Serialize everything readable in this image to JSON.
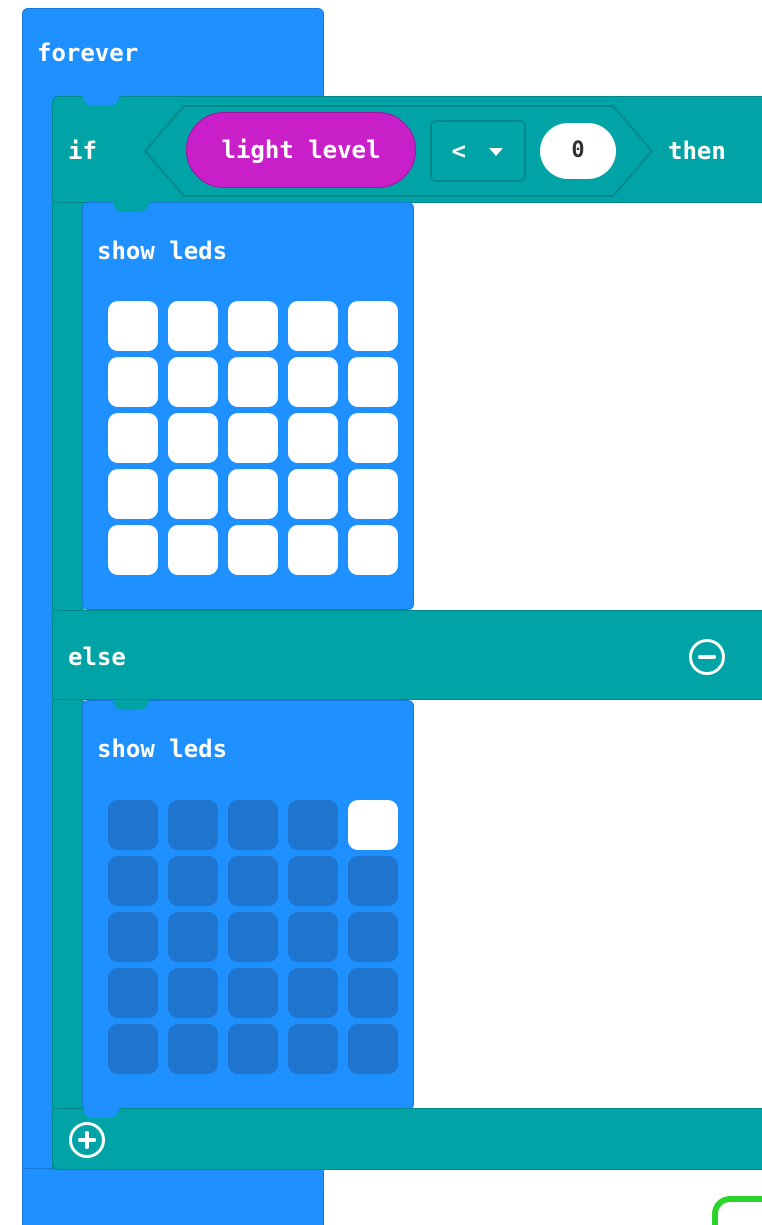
{
  "forever_block": {
    "label": "forever",
    "color": "#1E90FF"
  },
  "if_block": {
    "color": "#00A4A6",
    "if_label": "if",
    "then_label": "then",
    "else_label": "else",
    "remove_else_icon": "minus-circle-icon",
    "add_branch_icon": "plus-circle-icon",
    "condition": {
      "sensor_label": "light level",
      "sensor_color": "#C91FC8",
      "operator": "<",
      "operator_dropdown_icon": "caret-down-icon",
      "value": "0"
    }
  },
  "then_branch": {
    "label": "show leds",
    "leds": [
      [
        true,
        true,
        true,
        true,
        true
      ],
      [
        true,
        true,
        true,
        true,
        true
      ],
      [
        true,
        true,
        true,
        true,
        true
      ],
      [
        true,
        true,
        true,
        true,
        true
      ],
      [
        true,
        true,
        true,
        true,
        true
      ]
    ]
  },
  "else_branch": {
    "label": "show leds",
    "leds": [
      [
        false,
        false,
        false,
        false,
        true
      ],
      [
        false,
        false,
        false,
        false,
        false
      ],
      [
        false,
        false,
        false,
        false,
        false
      ],
      [
        false,
        false,
        false,
        false,
        false
      ],
      [
        false,
        false,
        false,
        false,
        false
      ]
    ]
  },
  "colors": {
    "led_on": "#FFFFFF",
    "led_off": "#1F74CE",
    "green_outline": "#2AD42A"
  }
}
